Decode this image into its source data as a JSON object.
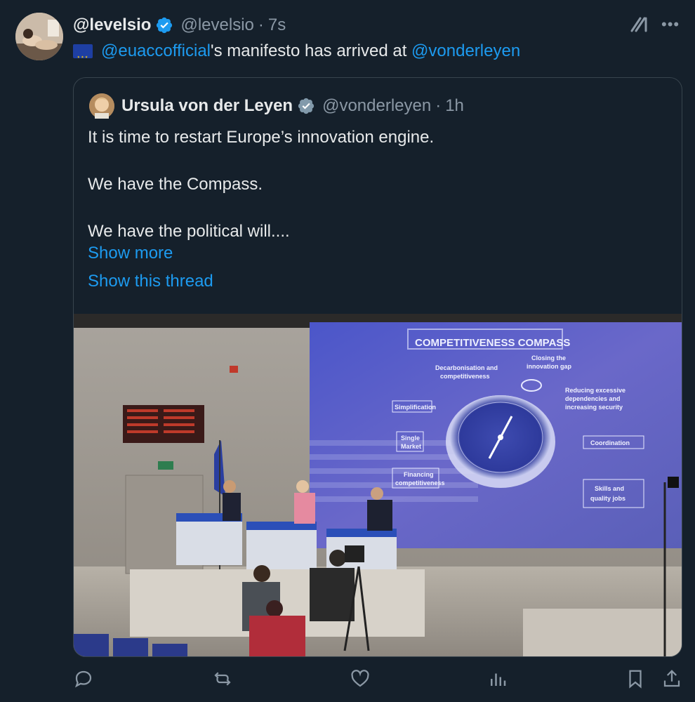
{
  "author": {
    "name": "@levelsio",
    "handle": "@levelsio",
    "time": "7s"
  },
  "tweet": {
    "mention1": "@euaccofficial",
    "middle_text": "'s manifesto has arrived at ",
    "mention2": "@vonderleyen"
  },
  "quoted": {
    "name": "Ursula von der Leyen",
    "handle": "@vonderleyen",
    "time": "1h",
    "lines": [
      "It is time to restart Europe’s innovation engine.",
      "We have the Compass.",
      "We have the political will...."
    ],
    "show_more": "Show more",
    "show_thread": "Show this thread"
  },
  "media": {
    "screen_title": "COMPETITIVENESS COMPASS",
    "labels": {
      "closing_gap": [
        "Closing the",
        "innovation gap"
      ],
      "decarb": [
        "Decarbonisation and",
        "competitiveness"
      ],
      "reducing": [
        "Reducing excessive",
        "dependencies and",
        "increasing security"
      ],
      "simplification": "Simplification",
      "single_market": [
        "Single",
        "Market"
      ],
      "coordination": "Coordination",
      "financing": [
        "Financing",
        "competitiveness"
      ],
      "skills": [
        "Skills and",
        "quality jobs"
      ]
    }
  },
  "icons": {
    "verified": "verified-badge-icon",
    "grok": "grok-icon",
    "more": "more-icon",
    "reply": "reply-icon",
    "retweet": "retweet-icon",
    "like": "like-icon",
    "views": "views-icon",
    "bookmark": "bookmark-icon",
    "share": "share-icon"
  },
  "colors": {
    "background": "#15202b",
    "link": "#1d9bf0",
    "secondary_text": "#8b98a5",
    "screen": "#5a5fc4"
  }
}
